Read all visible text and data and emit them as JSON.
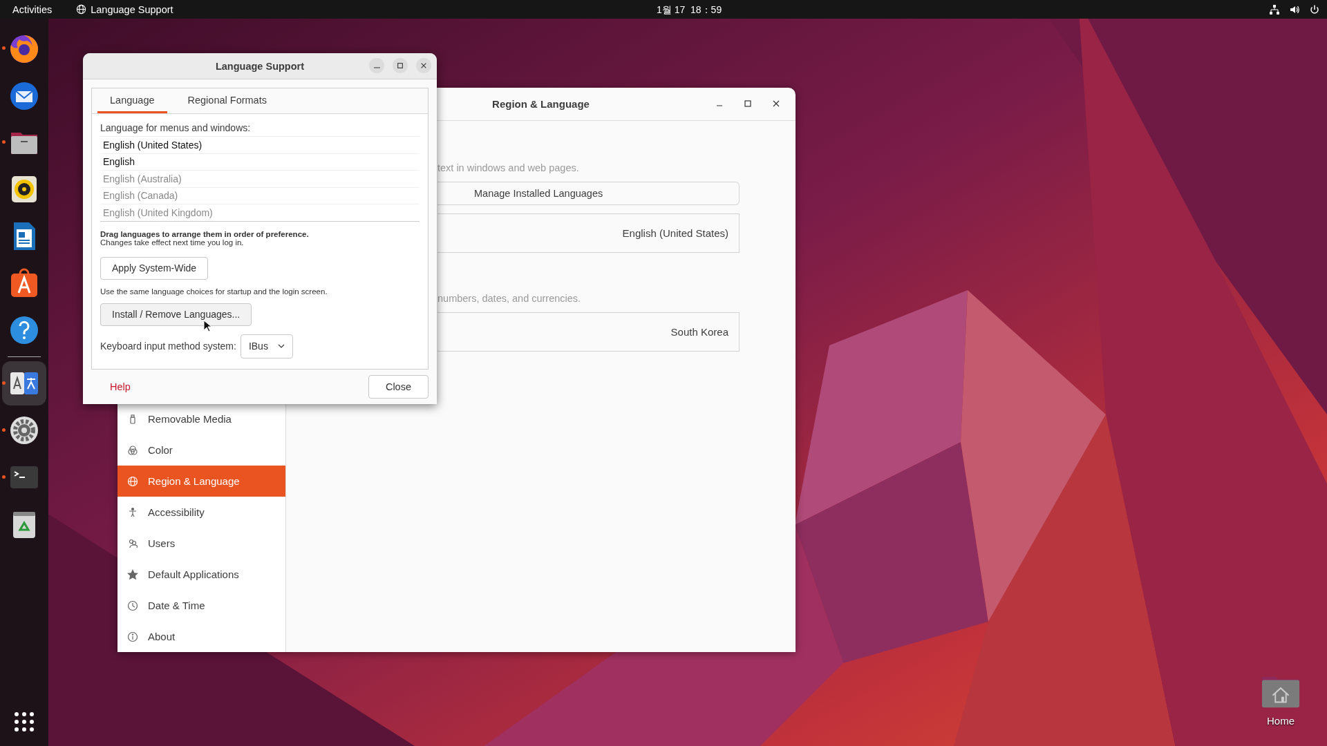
{
  "top_bar": {
    "activities": "Activities",
    "app_name": "Language Support",
    "clock": "1월 17  18：59"
  },
  "dock": [
    {
      "running": true,
      "selected": false
    },
    {
      "running": false,
      "selected": false
    },
    {
      "running": true,
      "selected": false
    },
    {
      "running": false,
      "selected": false
    },
    {
      "running": false,
      "selected": false
    },
    {
      "running": false,
      "selected": false
    },
    {
      "running": false,
      "selected": false
    },
    {
      "running": true,
      "selected": true
    },
    {
      "running": true,
      "selected": false
    },
    {
      "running": true,
      "selected": false
    },
    {
      "running": false,
      "selected": false
    }
  ],
  "desktop_icons": [
    {
      "label": "Home"
    }
  ],
  "settings_window": {
    "title": "Region & Language",
    "sidebar": [
      {
        "label": "Removable Media",
        "selected": false
      },
      {
        "label": "Color",
        "selected": false
      },
      {
        "label": "Region & Language",
        "selected": true
      },
      {
        "label": "Accessibility",
        "selected": false
      },
      {
        "label": "Users",
        "selected": false
      },
      {
        "label": "Default Applications",
        "selected": false
      },
      {
        "label": "Date & Time",
        "selected": false
      },
      {
        "label": "About",
        "selected": false
      }
    ],
    "language_description": "text in windows and web pages.",
    "manage_button": "Manage Installed Languages",
    "language_value": "English (United States)",
    "formats_description": "numbers, dates, and currencies.",
    "formats_value": "South Korea"
  },
  "dialog": {
    "title": "Language Support",
    "tabs": [
      {
        "label": "Language",
        "selected": true
      },
      {
        "label": "Regional Formats",
        "selected": false
      }
    ],
    "list_label": "Language for menus and windows:",
    "languages": [
      {
        "label": "English (United States)",
        "disabled": false
      },
      {
        "label": "English",
        "disabled": false
      },
      {
        "label": "English (Australia)",
        "disabled": true
      },
      {
        "label": "English (Canada)",
        "disabled": true
      },
      {
        "label": "English (United Kingdom)",
        "disabled": true
      }
    ],
    "drag_hint": "Drag languages to arrange them in order of preference.",
    "changes_note": "Changes take effect next time you log in.",
    "apply_button": "Apply System-Wide",
    "apply_note": "Use the same language choices for startup and the login screen.",
    "install_button": "Install / Remove Languages...",
    "keyboard_label": "Keyboard input method system:",
    "keyboard_value": "IBus",
    "help": "Help",
    "close_button": "Close"
  }
}
